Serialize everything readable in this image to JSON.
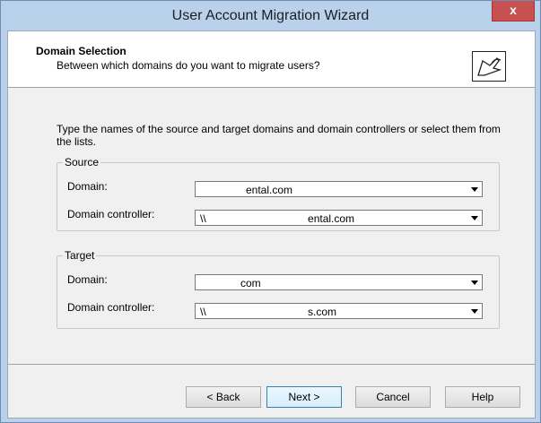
{
  "window": {
    "title": "User Account Migration Wizard",
    "close_label": "x"
  },
  "header": {
    "title": "Domain Selection",
    "subtitle": "Between which domains do you want to migrate users?",
    "icon": "wizard-arrow-icon"
  },
  "instructions": "Type the names of the source and target domains and domain controllers or select them from the lists.",
  "source": {
    "legend": "Source",
    "domain_label": "Domain:",
    "domain_value": "ental.com",
    "controller_label": "Domain controller:",
    "controller_value": "\\\\                                  ental.com"
  },
  "target": {
    "legend": "Target",
    "domain_label": "Domain:",
    "domain_value": "com",
    "controller_label": "Domain controller:",
    "controller_value": "\\\\                                  s.com"
  },
  "buttons": {
    "back": "< Back",
    "next": "Next >",
    "cancel": "Cancel",
    "help": "Help"
  },
  "colors": {
    "titlebar": "#b9d1ea",
    "close": "#c75050",
    "dialog_bg": "#f0f0f0"
  }
}
